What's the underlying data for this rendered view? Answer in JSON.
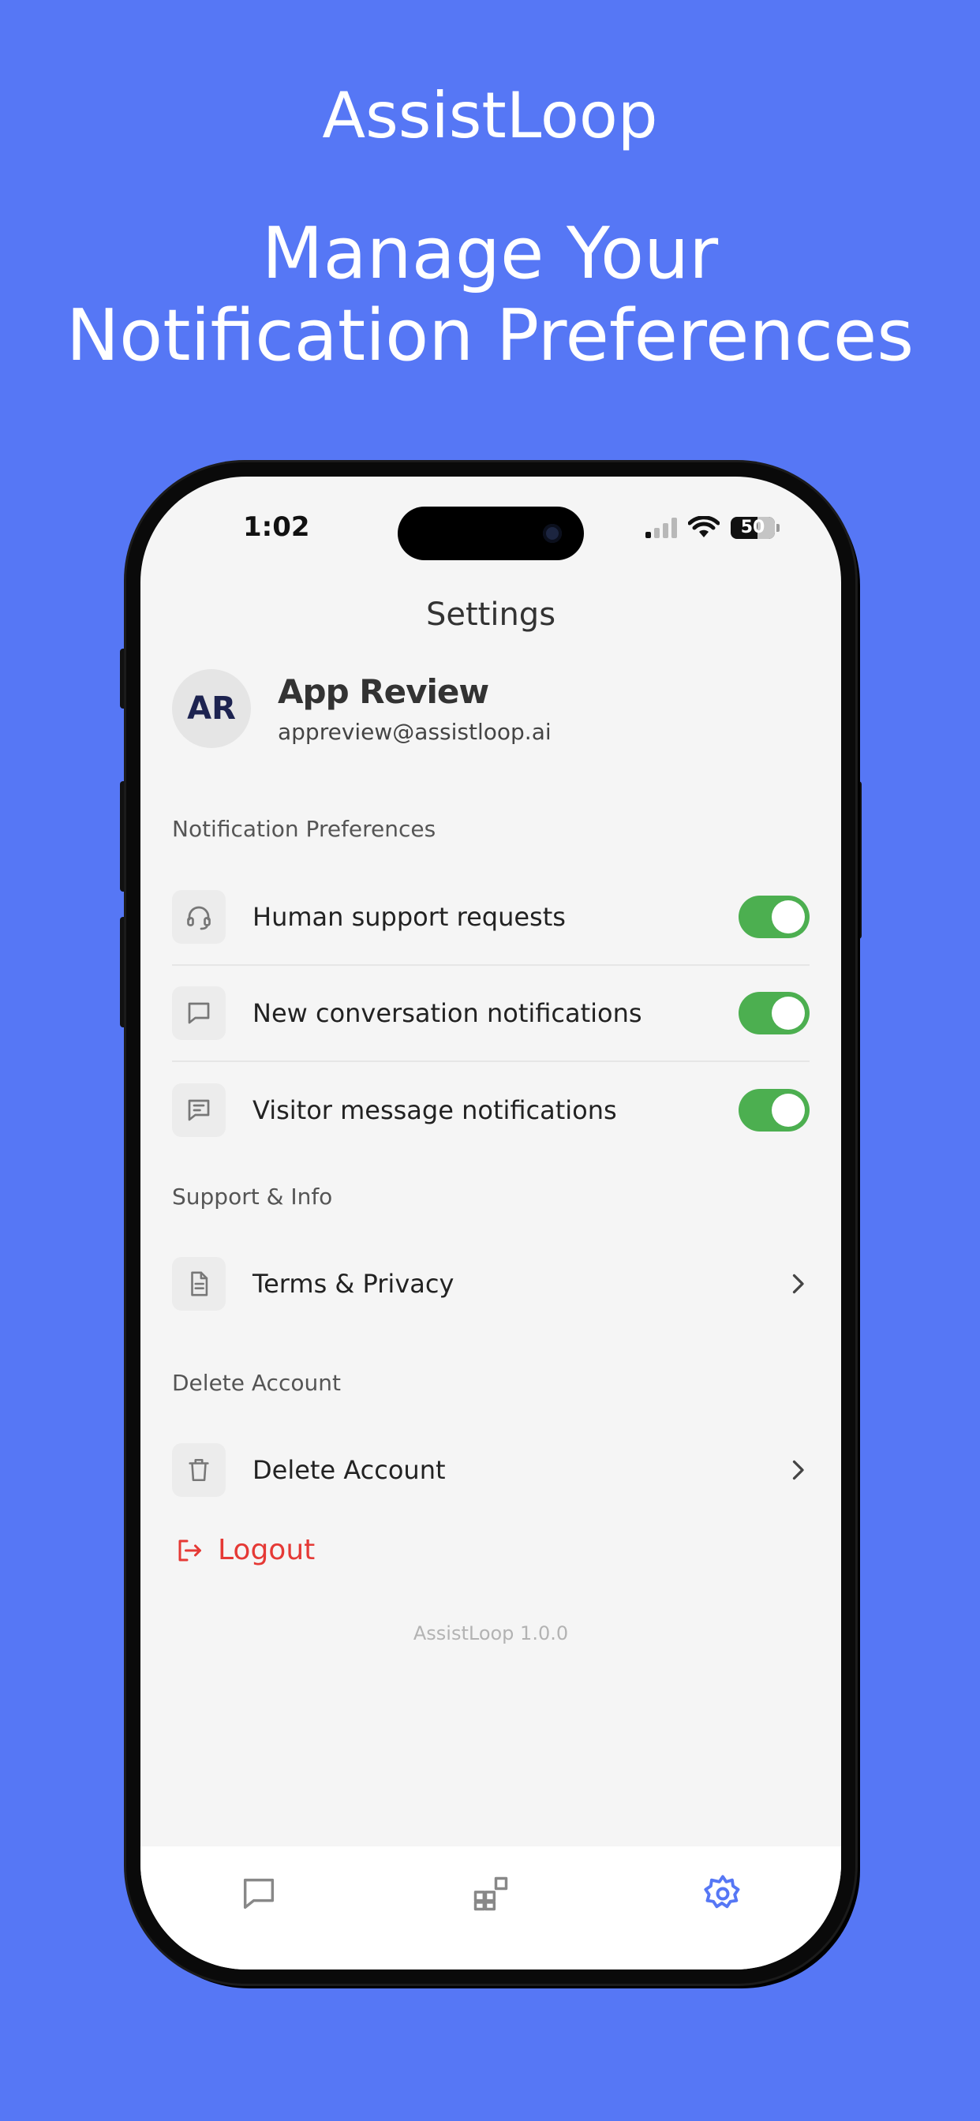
{
  "promo": {
    "brand": "AssistLoop",
    "headline_line1": "Manage Your",
    "headline_line2": "Notification Preferences"
  },
  "status_bar": {
    "time": "1:02",
    "battery": "50"
  },
  "nav": {
    "title": "Settings"
  },
  "profile": {
    "initials": "AR",
    "name": "App Review",
    "email": "appreview@assistloop.ai"
  },
  "notification_section": {
    "label": "Notification Preferences",
    "items": [
      {
        "label": "Human support requests",
        "icon": "headset-icon",
        "enabled": true
      },
      {
        "label": "New conversation notifications",
        "icon": "chat-bubble-icon",
        "enabled": true
      },
      {
        "label": "Visitor message notifications",
        "icon": "message-lines-icon",
        "enabled": true
      }
    ]
  },
  "support_section": {
    "label": "Support & Info",
    "items": [
      {
        "label": "Terms & Privacy",
        "icon": "document-icon"
      }
    ]
  },
  "delete_section": {
    "label": "Delete Account",
    "items": [
      {
        "label": "Delete Account",
        "icon": "trash-icon"
      }
    ]
  },
  "logout": {
    "label": "Logout",
    "color": "#e53935"
  },
  "version": "AssistLoop 1.0.0",
  "tabbar": {
    "tabs": [
      {
        "icon": "chat-bubble-icon",
        "active": false
      },
      {
        "icon": "widgets-icon",
        "active": false
      },
      {
        "icon": "gear-icon",
        "active": true
      }
    ],
    "active_color": "#5677f5"
  },
  "colors": {
    "background": "#5677f5",
    "toggle_on": "#4caf50"
  }
}
